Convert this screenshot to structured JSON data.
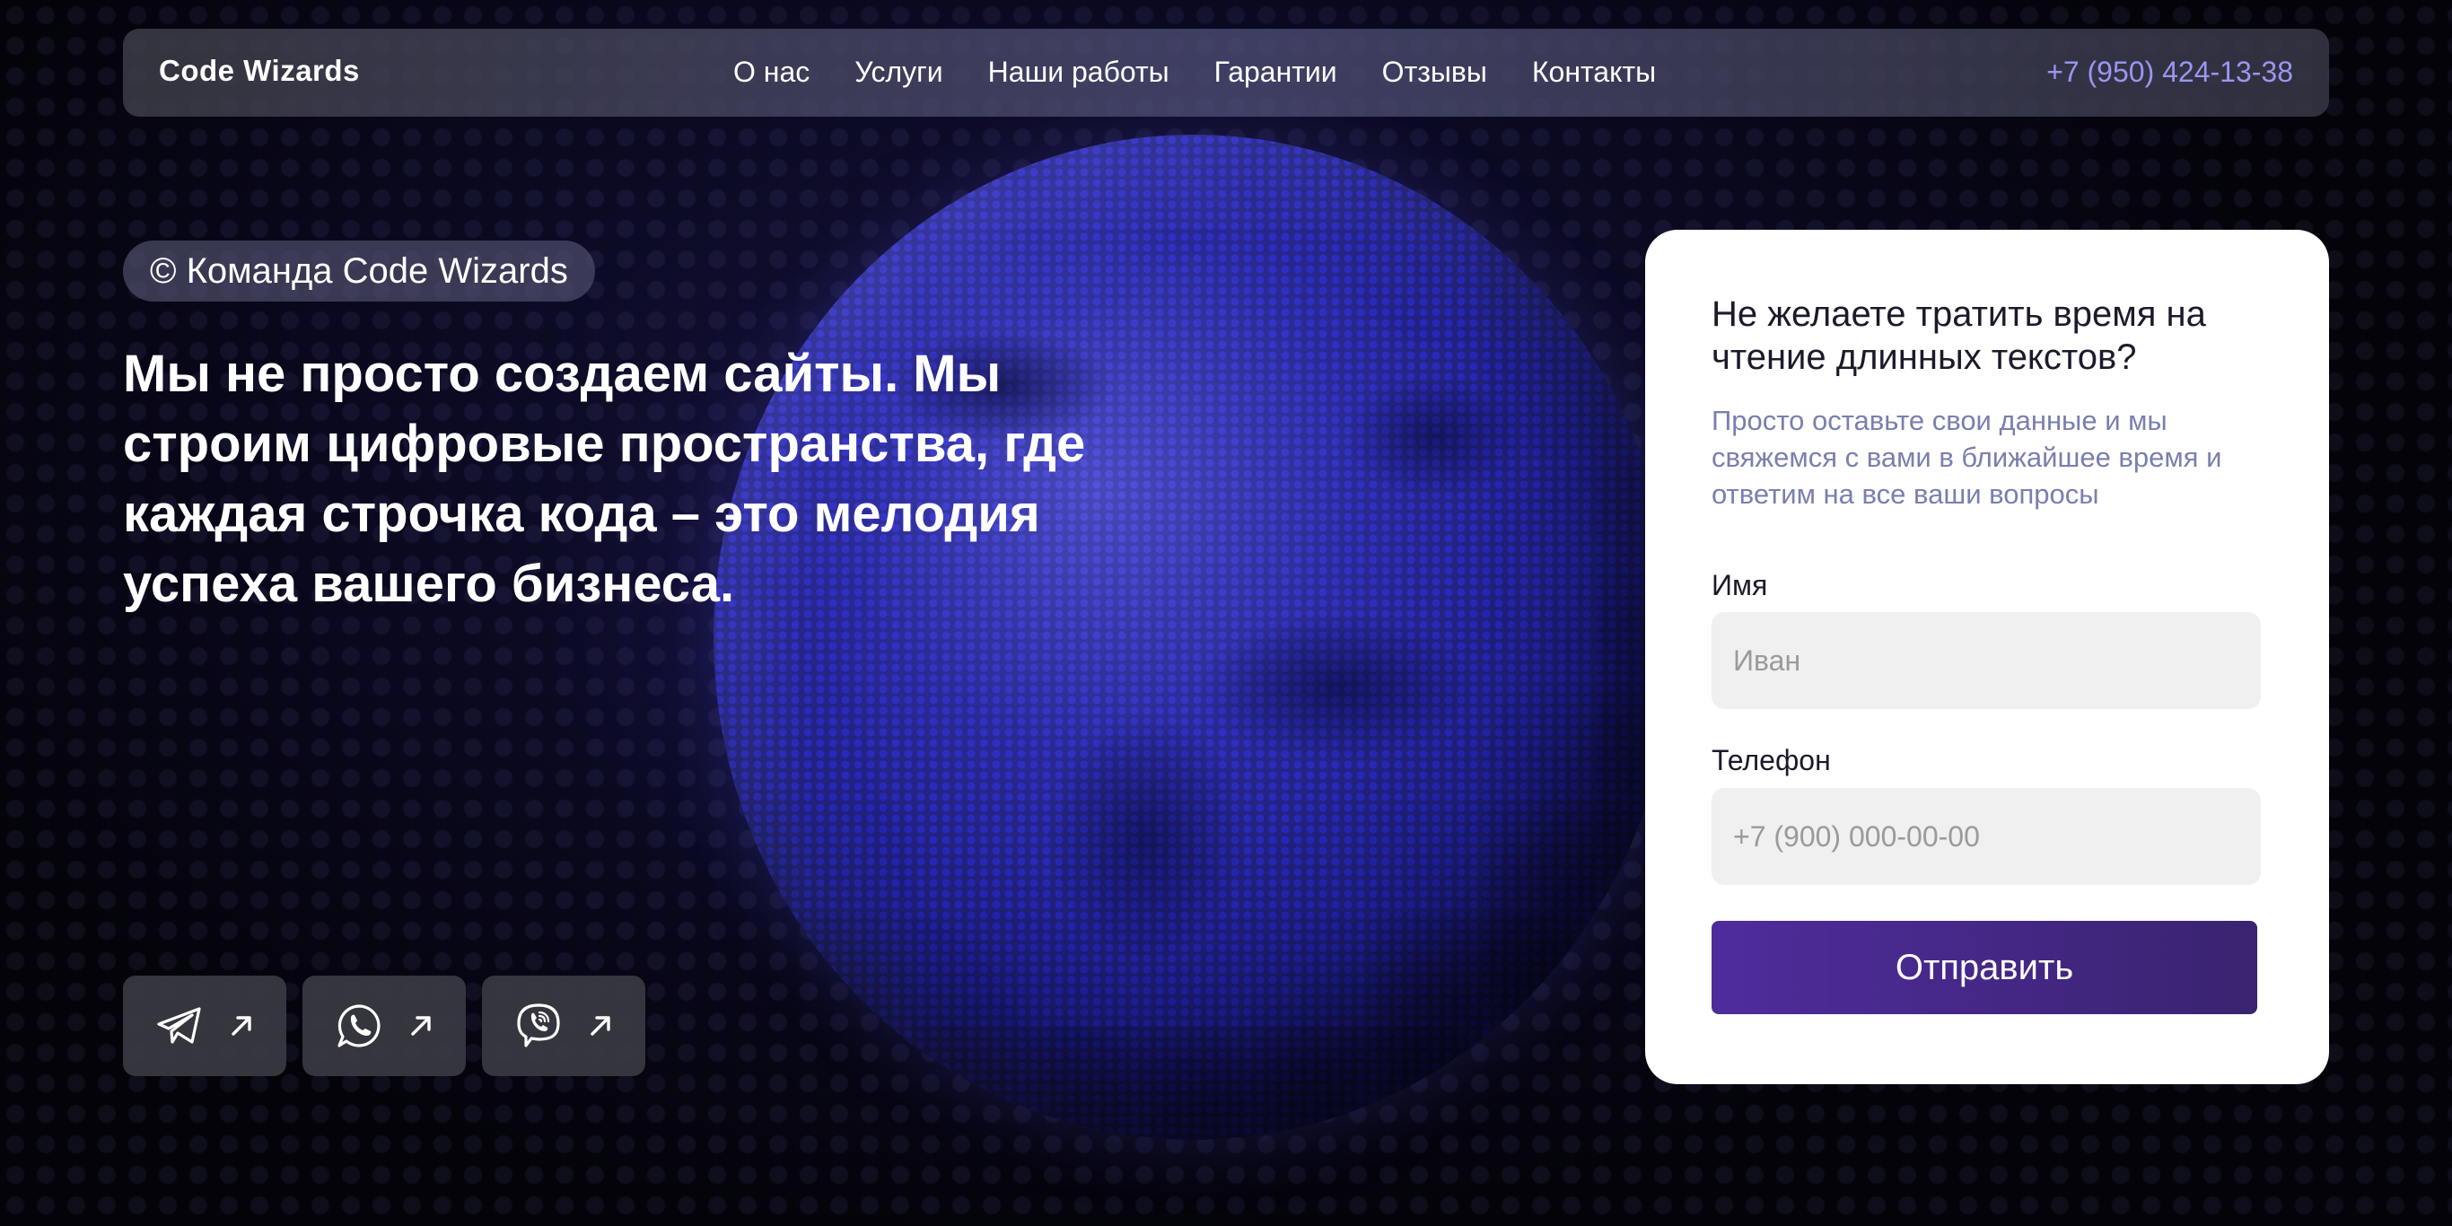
{
  "header": {
    "logo": "Code Wizards",
    "nav": [
      "О нас",
      "Услуги",
      "Наши работы",
      "Гарантии",
      "Отзывы",
      "Контакты"
    ],
    "phone": "+7 (950) 424-13-38"
  },
  "hero": {
    "badge": "© Команда Code Wizards",
    "headline": "Мы не просто создаем сайты. Мы строим цифровые пространства, где каждая строчка кода – это мелодия успеха вашего бизнеса."
  },
  "socials": [
    {
      "icon": "telegram-icon",
      "arrow": "arrow-up-right-icon"
    },
    {
      "icon": "whatsapp-icon",
      "arrow": "arrow-up-right-icon"
    },
    {
      "icon": "viber-icon",
      "arrow": "arrow-up-right-icon"
    }
  ],
  "form": {
    "title": "Не желаете тратить время на чтение длинных текстов?",
    "subtitle": "Просто оставьте свои данные и мы свяжемся с вами в ближайшее время и ответим на все ваши вопросы",
    "name_label": "Имя",
    "name_placeholder": "Иван",
    "phone_label": "Телефон",
    "phone_placeholder": "+7 (900) 000-00-00",
    "submit_label": "Отправить"
  },
  "colors": {
    "accent": "#9a96f0",
    "button": "#4f2c9c",
    "subtitle": "#7a7fae"
  }
}
